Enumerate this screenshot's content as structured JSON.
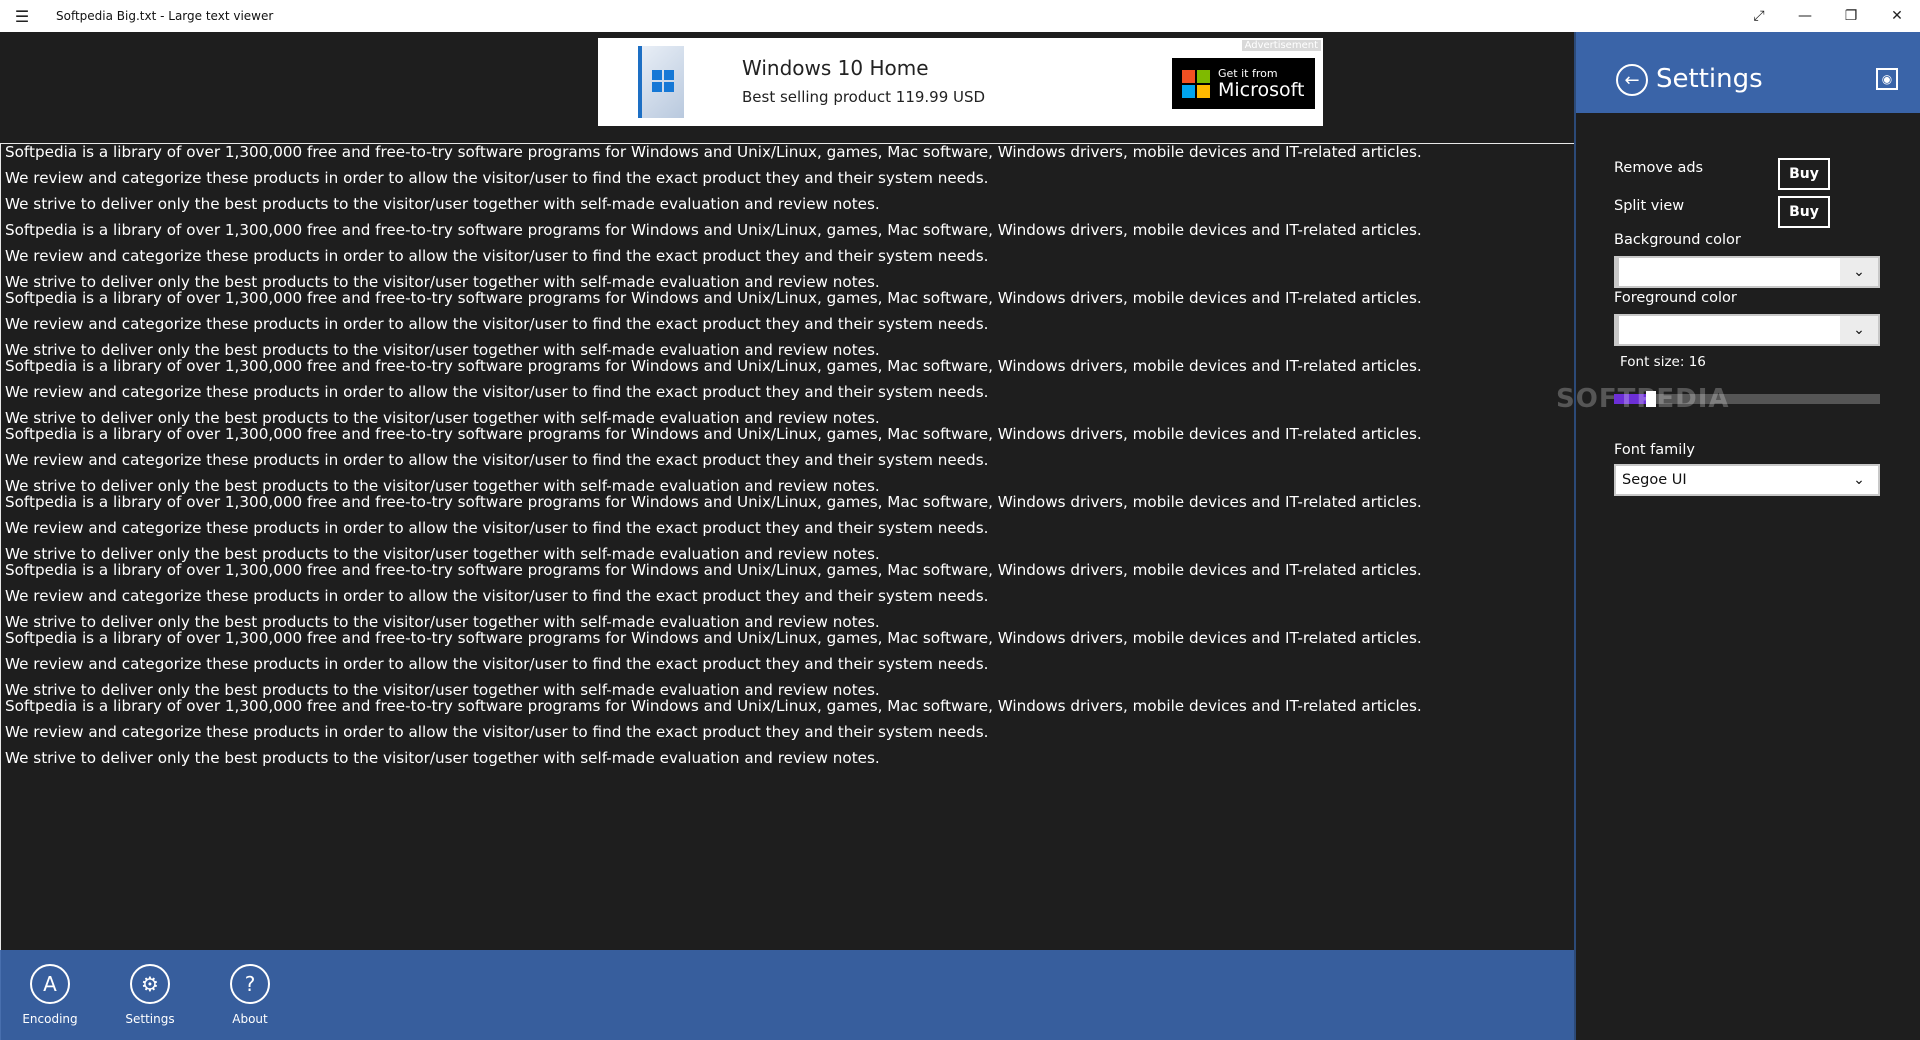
{
  "window": {
    "title": "Softpedia Big.txt - Large text viewer",
    "controls": [
      "⤢",
      "—",
      "❐",
      "✕"
    ]
  },
  "ad": {
    "tag": "Advertisement",
    "title": "Windows 10 Home",
    "subtitle": "Best selling product   119.99 USD",
    "badge_small": "Get it from",
    "badge_big": "Microsoft"
  },
  "text_lines": [
    "Softpedia is a library of over 1,300,000 free and free-to-try software programs for Windows and Unix/Linux, games, Mac software, Windows drivers, mobile devices and IT-related articles.",
    "",
    "We review and categorize these products in order to allow the visitor/user to find the exact product they and their system needs.",
    "",
    "We strive to deliver only the best products to the visitor/user together with self-made evaluation and review notes.",
    "",
    "Softpedia is a library of over 1,300,000 free and free-to-try software programs for Windows and Unix/Linux, games, Mac software, Windows drivers, mobile devices and IT-related articles.",
    "",
    "We review and categorize these products in order to allow the visitor/user to find the exact product they and their system needs.",
    "",
    "We strive to deliver only the best products to the visitor/user together with self-made evaluation and review notes.",
    "Softpedia is a library of over 1,300,000 free and free-to-try software programs for Windows and Unix/Linux, games, Mac software, Windows drivers, mobile devices and IT-related articles.",
    "",
    "We review and categorize these products in order to allow the visitor/user to find the exact product they and their system needs.",
    "",
    "We strive to deliver only the best products to the visitor/user together with self-made evaluation and review notes.",
    "Softpedia is a library of over 1,300,000 free and free-to-try software programs for Windows and Unix/Linux, games, Mac software, Windows drivers, mobile devices and IT-related articles.",
    "",
    "We review and categorize these products in order to allow the visitor/user to find the exact product they and their system needs.",
    "",
    "We strive to deliver only the best products to the visitor/user together with self-made evaluation and review notes.",
    "Softpedia is a library of over 1,300,000 free and free-to-try software programs for Windows and Unix/Linux, games, Mac software, Windows drivers, mobile devices and IT-related articles.",
    "",
    "We review and categorize these products in order to allow the visitor/user to find the exact product they and their system needs.",
    "",
    "We strive to deliver only the best products to the visitor/user together with self-made evaluation and review notes.",
    "Softpedia is a library of over 1,300,000 free and free-to-try software programs for Windows and Unix/Linux, games, Mac software, Windows drivers, mobile devices and IT-related articles.",
    "",
    "We review and categorize these products in order to allow the visitor/user to find the exact product they and their system needs.",
    "",
    "We strive to deliver only the best products to the visitor/user together with self-made evaluation and review notes.",
    "Softpedia is a library of over 1,300,000 free and free-to-try software programs for Windows and Unix/Linux, games, Mac software, Windows drivers, mobile devices and IT-related articles.",
    "",
    "We review and categorize these products in order to allow the visitor/user to find the exact product they and their system needs.",
    "",
    "We strive to deliver only the best products to the visitor/user together with self-made evaluation and review notes.",
    "Softpedia is a library of over 1,300,000 free and free-to-try software programs for Windows and Unix/Linux, games, Mac software, Windows drivers, mobile devices and IT-related articles.",
    "",
    "We review and categorize these products in order to allow the visitor/user to find the exact product they and their system needs.",
    "",
    "We strive to deliver only the best products to the visitor/user together with self-made evaluation and review notes.",
    "Softpedia is a library of over 1,300,000 free and free-to-try software programs for Windows and Unix/Linux, games, Mac software, Windows drivers, mobile devices and IT-related articles.",
    "",
    "We review and categorize these products in order to allow the visitor/user to find the exact product they and their system needs.",
    "",
    "We strive to deliver only the best products to the visitor/user together with self-made evaluation and review notes."
  ],
  "appbar": {
    "encoding_label": "Encoding",
    "settings_label": "Settings",
    "about_label": "About"
  },
  "settings": {
    "title": "Settings",
    "remove_ads_label": "Remove ads",
    "split_view_label": "Split view",
    "buy_label": "Buy",
    "background_color_label": "Background color",
    "foreground_color_label": "Foreground color",
    "font_size_label": "Font size:  16",
    "font_size_value_fraction": 0.12,
    "font_family_label": "Font family",
    "font_family_value": "Segoe UI",
    "watermark": "SOFTPEDIA"
  },
  "colors": {
    "accent": "#3a64a8",
    "slider_fill": "#6c2fd6",
    "background": "#1e1e1e",
    "text": "#ffffff"
  }
}
